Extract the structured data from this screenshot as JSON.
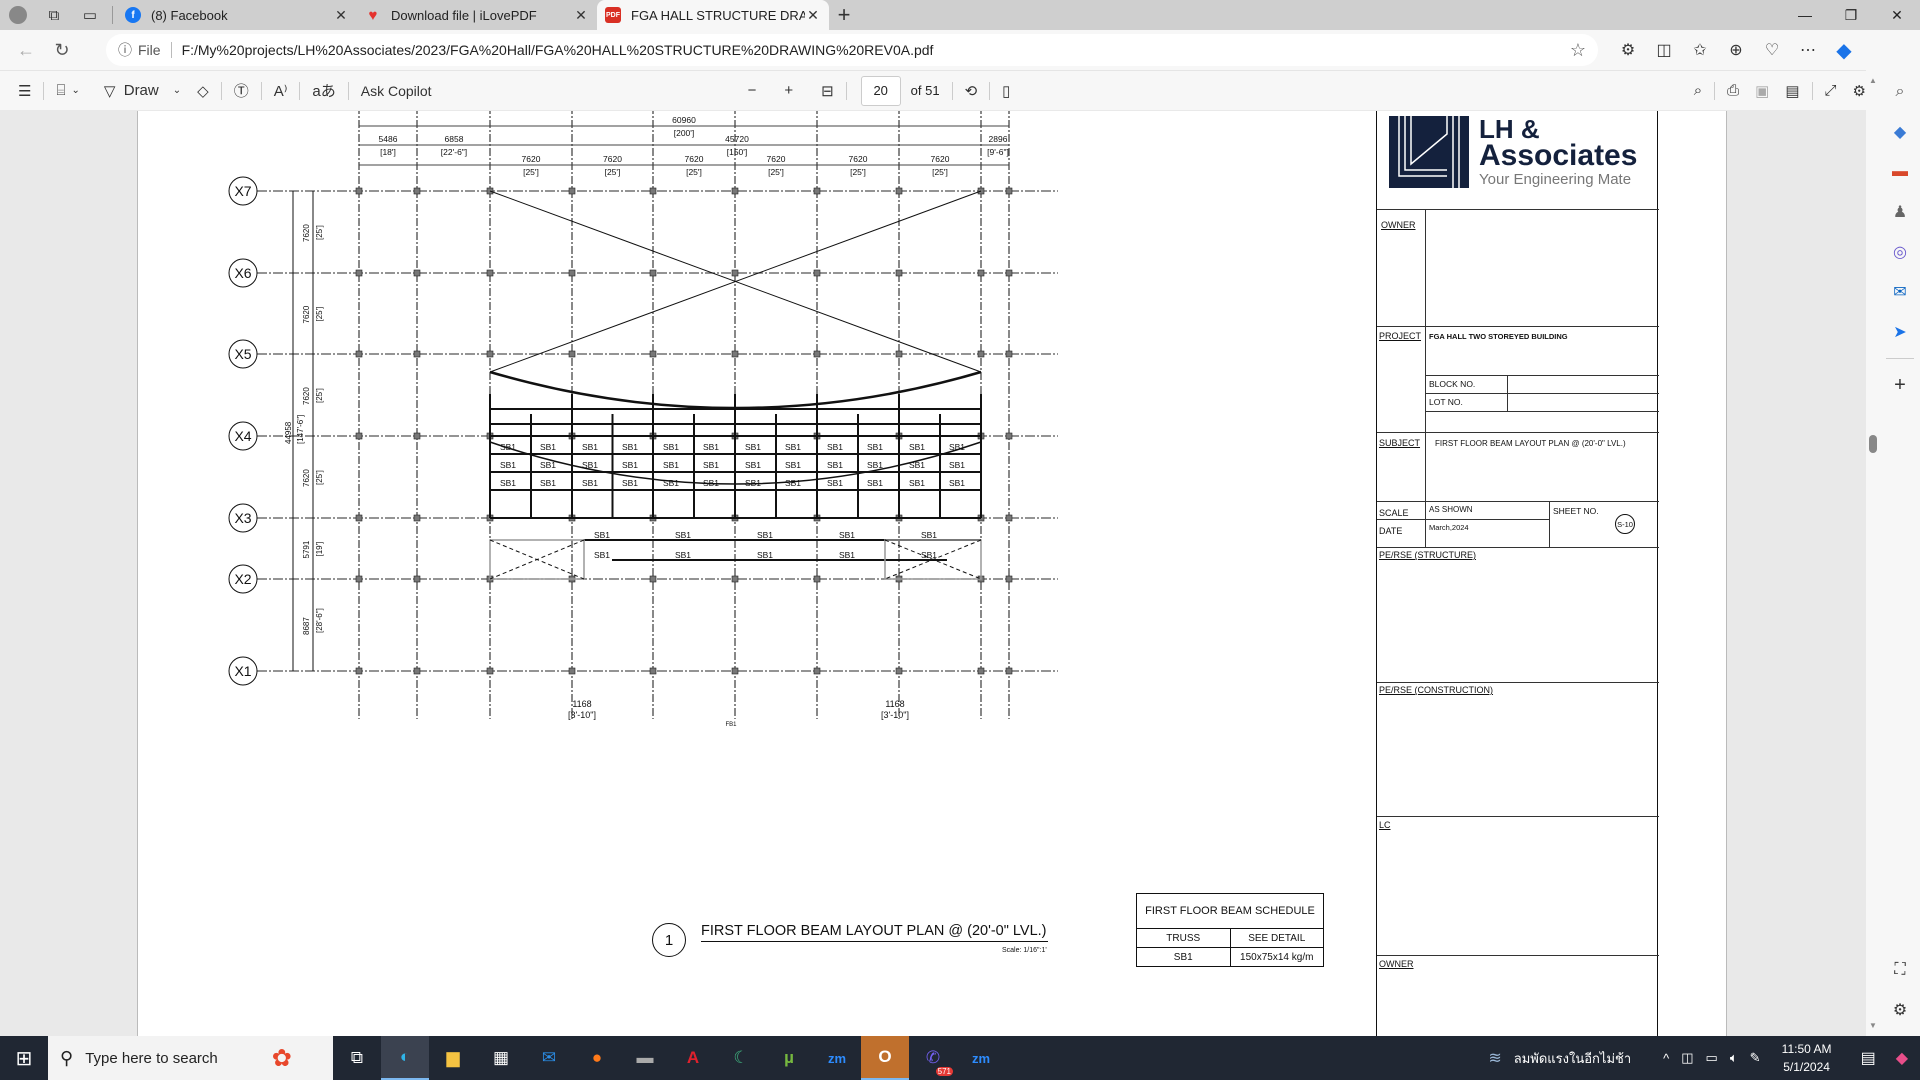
{
  "browser": {
    "tabs": [
      {
        "title": "(8) Facebook",
        "icon": "facebook-icon",
        "color": "#1877f2"
      },
      {
        "title": "Download file | iLovePDF",
        "icon": "ilovepdf-heart-icon",
        "color": "#e5322d"
      },
      {
        "title": "FGA HALL STRUCTURE DRAWING",
        "icon": "pdf-icon",
        "color": "#d93025",
        "active": true
      }
    ],
    "address_prefix": "File",
    "url": "F:/My%20projects/LH%20Associates/2023/FGA%20Hall/FGA%20HALL%20STRUCTURE%20DRAWING%20REV0A.pdf"
  },
  "pdf_toolbar": {
    "draw_label": "Draw",
    "ask_copilot_label": "Ask Copilot",
    "current_page": "20",
    "total_pages": "of 51"
  },
  "drawing": {
    "top_dims": {
      "overall": "60960",
      "overall_ft": "[200']",
      "middle": "45720",
      "middle_ft": "[150']",
      "left1": "5486",
      "left1_ft": "[18']",
      "left2": "6858",
      "left2_ft": "[22'-6\"]",
      "bay": "7620",
      "bay_ft": "[25']",
      "right": "2896",
      "right_ft": "[9'-6\"]"
    },
    "grid_labels": [
      "X7",
      "X6",
      "X5",
      "X4",
      "X3",
      "X2",
      "X1"
    ],
    "side_dims": [
      {
        "mm": "7620",
        "ft": "[25']"
      },
      {
        "mm": "7620",
        "ft": "[25']"
      },
      {
        "mm": "7620",
        "ft": "[25']"
      },
      {
        "mm": "7620",
        "ft": "[25']"
      },
      {
        "mm": "5791",
        "ft": "[19']"
      },
      {
        "mm": "8687",
        "ft": "[28'-6\"]"
      }
    ],
    "overall_side": "44958",
    "overall_side_ft": "[147'-6\"]",
    "bottom_dim": "1168",
    "bottom_dim_ft": "[3'-10\"]",
    "fb_label": "FB1",
    "beam_label": "SB1",
    "caption_number": "1",
    "caption_title": "FIRST FLOOR BEAM LAYOUT PLAN @  (20'-0\" LVL.)",
    "caption_scale": "Scale: 1/16\":1'"
  },
  "schedule": {
    "title": "FIRST FLOOR BEAM SCHEDULE",
    "col1": "TRUSS",
    "col2": "SEE DETAIL",
    "rows": [
      {
        "name": "SB1",
        "detail": "150x75x14 kg/m"
      }
    ]
  },
  "title_block": {
    "logo_line1": "LH &",
    "logo_line2": "Associates",
    "logo_tagline": "Your Engineering Mate",
    "owner_label": "OWNER",
    "project_label": "PROJECT",
    "project_value": "FGA HALL TWO STOREYED BUILDING",
    "block_label": "BLOCK NO.",
    "lot_label": "LOT NO.",
    "subject_label": "SUBJECT",
    "subject_value": "FIRST FLOOR BEAM LAYOUT PLAN @  (20'-0\" LVL.)",
    "scale_label": "SCALE",
    "scale_value": "AS SHOWN",
    "sheet_label": "SHEET NO.",
    "sheet_value": "S-10",
    "date_label": "DATE",
    "date_value": "March,2024",
    "pe_structure": "PE/RSE (STRUCTURE)",
    "pe_construction": "PE/RSE (CONSTRUCTION)",
    "lc_label": "LC",
    "owner2_label": "OWNER",
    "brand_color": "#14213d"
  },
  "taskbar": {
    "search_placeholder": "Type here to search",
    "weather_text": "ลมพัดแรงในอีกไม่ช้า",
    "time": "11:50 AM",
    "date": "5/1/2024",
    "viber_badge": "571"
  }
}
